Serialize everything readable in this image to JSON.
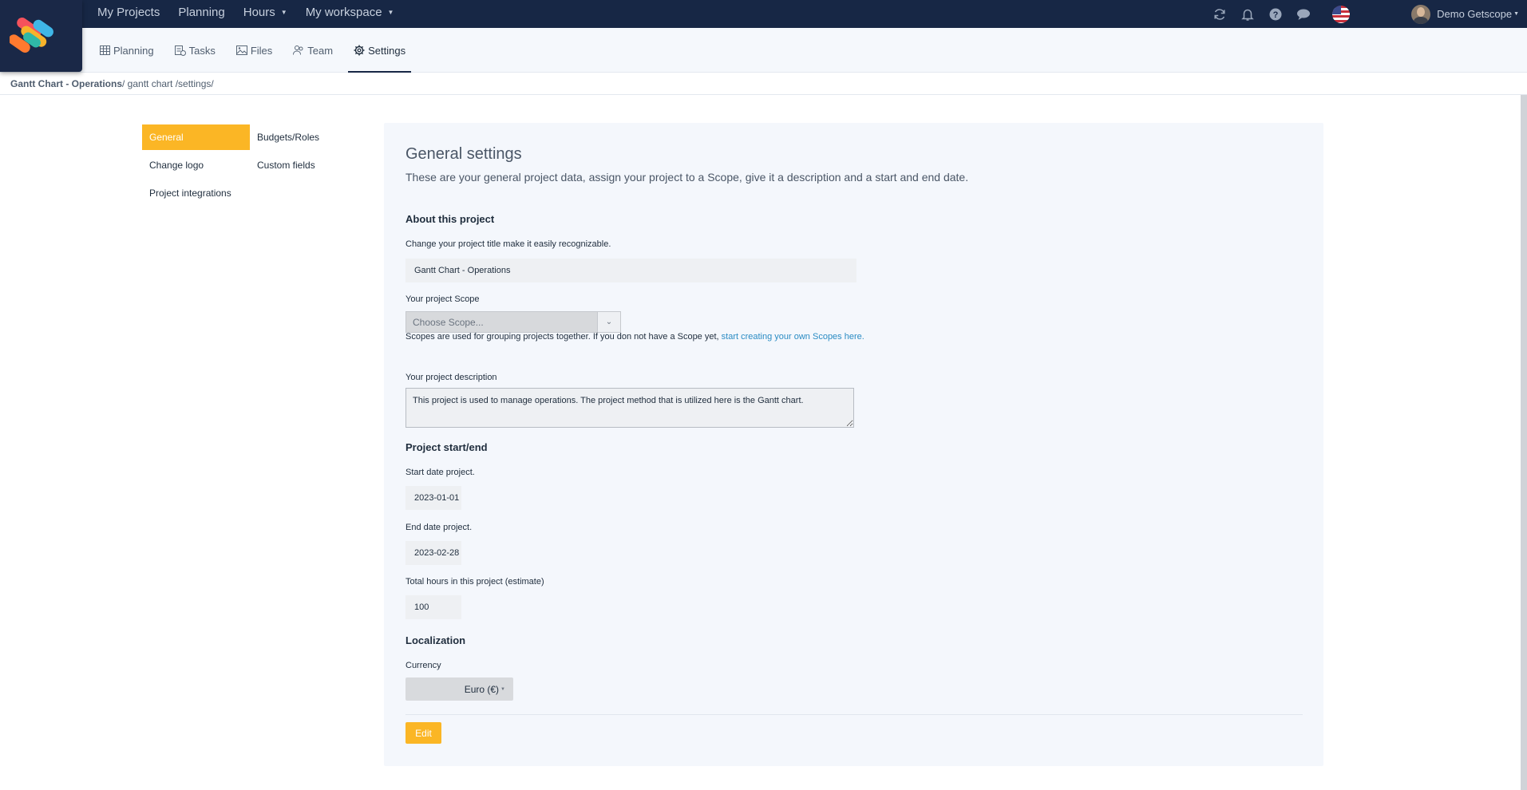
{
  "topnav": {
    "items": [
      {
        "label": "My Projects",
        "dropdown": false
      },
      {
        "label": "Planning",
        "dropdown": false
      },
      {
        "label": "Hours",
        "dropdown": true
      },
      {
        "label": "My workspace",
        "dropdown": true
      }
    ],
    "icons": [
      "refresh-icon",
      "bell-icon",
      "help-icon",
      "chat-icon",
      "us-flag-icon"
    ],
    "user_name": "Demo Getscope"
  },
  "subtabs": [
    {
      "label": "Planning",
      "icon": "grid-icon",
      "active": false
    },
    {
      "label": "Tasks",
      "icon": "tasks-icon",
      "active": false
    },
    {
      "label": "Files",
      "icon": "image-icon",
      "active": false
    },
    {
      "label": "Team",
      "icon": "team-icon",
      "active": false
    },
    {
      "label": "Settings",
      "icon": "gear-icon",
      "active": true
    }
  ],
  "breadcrumb": {
    "project": "Gantt Chart - Operations",
    "path": "/ gantt chart /settings/"
  },
  "menu": {
    "general": "General",
    "budgets_roles": "Budgets/Roles",
    "change_logo": "Change logo",
    "custom_fields": "Custom fields",
    "project_integrations": "Project integrations"
  },
  "settings": {
    "title": "General settings",
    "subtitle": "These are your general project data, assign your project to a Scope, give it a description and a start and end date.",
    "about_heading": "About this project",
    "title_label": "Change your project title make it easily recognizable.",
    "title_value": "Gantt Chart - Operations",
    "scope_label": "Your project Scope",
    "scope_placeholder": "Choose Scope...",
    "scope_help": "Scopes are used for grouping projects together. If you don not have a Scope yet, ",
    "scope_link": "start creating your own Scopes here.",
    "description_label": "Your project description",
    "description_value": "This project is used to manage operations. The project method that is utilized here is the Gantt chart.",
    "startend_heading": "Project start/end",
    "start_label": "Start date project.",
    "start_value": "2023-01-01",
    "end_label": "End date project.",
    "end_value": "2023-02-28",
    "hours_label": "Total hours in this project (estimate)",
    "hours_value": "100",
    "localization_heading": "Localization",
    "currency_label": "Currency",
    "currency_value": "Euro (€)",
    "edit_label": "Edit"
  },
  "colors": {
    "topbar": "#172745",
    "accent": "#fbb625",
    "link": "#2b8cc4",
    "panel": "#f4f7fc"
  }
}
